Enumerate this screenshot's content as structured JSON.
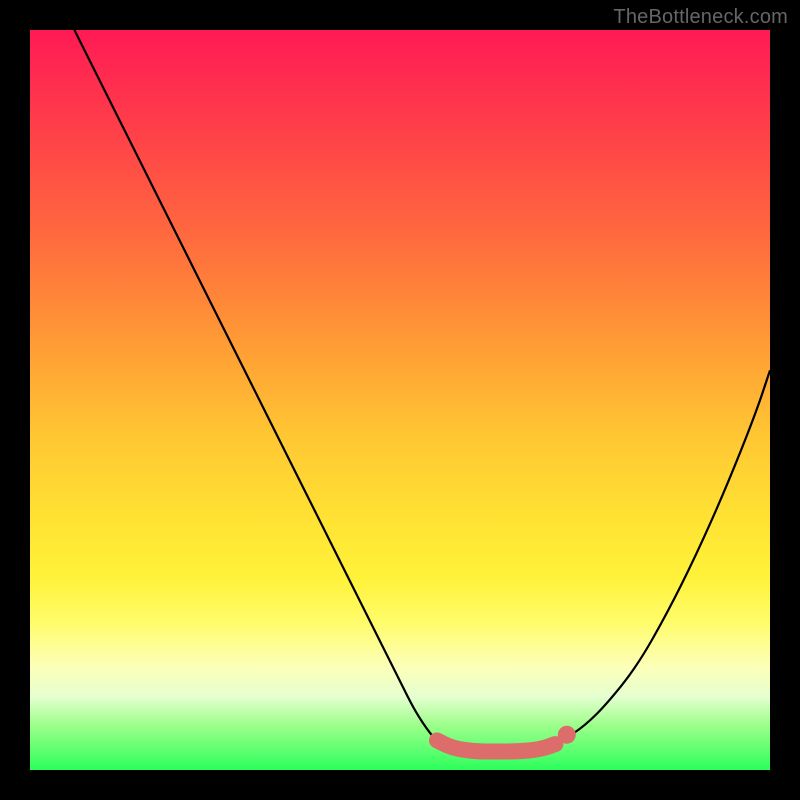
{
  "watermark": "TheBottleneck.com",
  "chart_data": {
    "type": "line",
    "title": "",
    "xlabel": "",
    "ylabel": "",
    "xlim": [
      0,
      100
    ],
    "ylim": [
      0,
      100
    ],
    "series": [
      {
        "name": "left-curve",
        "color": "#000000",
        "x": [
          6,
          10,
          15,
          20,
          25,
          30,
          35,
          40,
          45,
          50,
          52,
          54,
          55
        ],
        "y": [
          100,
          92,
          82,
          72,
          62,
          52,
          42,
          32,
          22,
          12,
          8,
          5,
          4
        ]
      },
      {
        "name": "right-curve",
        "color": "#000000",
        "x": [
          72,
          75,
          78,
          82,
          86,
          90,
          94,
          98,
          100
        ],
        "y": [
          4,
          6,
          9,
          14,
          21,
          29,
          38,
          48,
          54
        ]
      },
      {
        "name": "plateau-markers",
        "color": "#dd6d6a",
        "x": [
          55,
          57,
          60,
          63,
          66,
          69,
          71,
          72
        ],
        "y": [
          4,
          3,
          2.5,
          2.5,
          2.5,
          2.8,
          3.5,
          4.5
        ]
      }
    ]
  }
}
